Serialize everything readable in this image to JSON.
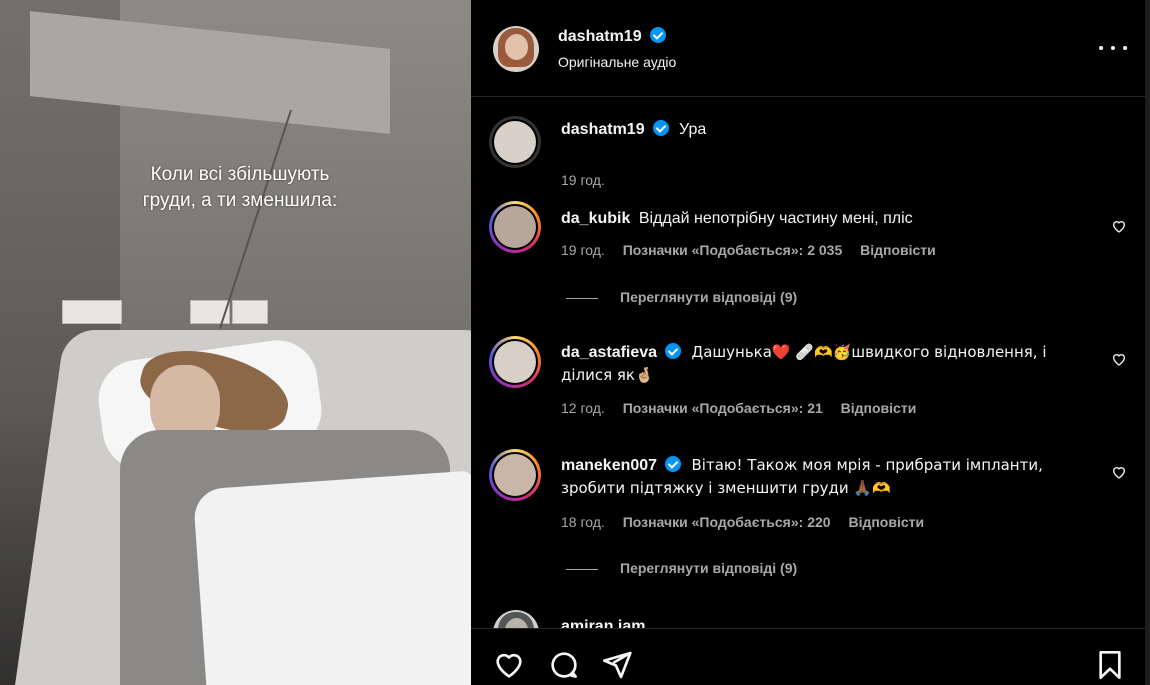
{
  "media": {
    "caption": "Коли всі збільшують\nгруди, а ти зменшила:"
  },
  "post": {
    "username": "dashatm19",
    "audio": "Оригінальне аудіо",
    "caption_text": "Ура",
    "caption_time": "19 год."
  },
  "comments": [
    {
      "username": "da_kubik",
      "verified": false,
      "text": "Віддай непотрібну частину мені, пліс",
      "time": "19 год.",
      "likes": "Позначки «Подобається»: 2 035",
      "reply": "Відповісти",
      "view_replies": "Переглянути відповіді (9)"
    },
    {
      "username": "da_astafieva",
      "verified": true,
      "text": "Дашунька❤️ 🩹🫶🥳швидкого відновлення, і ділися як🤞🏼",
      "time": "12 год.",
      "likes": "Позначки «Подобається»: 21",
      "reply": "Відповісти"
    },
    {
      "username": "maneken007",
      "verified": true,
      "text": "Вітаю! Також моя мрія - прибрати імпланти, зробити підтяжку і зменшити груди 🙏🏾🫶",
      "time": "18 год.",
      "likes": "Позначки «Подобається»: 220",
      "reply": "Відповісти",
      "view_replies": "Переглянути відповіді (9)"
    },
    {
      "username": "amiran.jam",
      "verified": false
    }
  ],
  "icons": {
    "like": "heart-icon",
    "comment": "comment-icon",
    "share": "send-icon",
    "save": "bookmark-icon",
    "more": "more-icon",
    "comment_like": "heart-outline-icon"
  },
  "colors": {
    "verified": "#0095f6",
    "muted": "#a8a8a8",
    "background": "#000000"
  }
}
